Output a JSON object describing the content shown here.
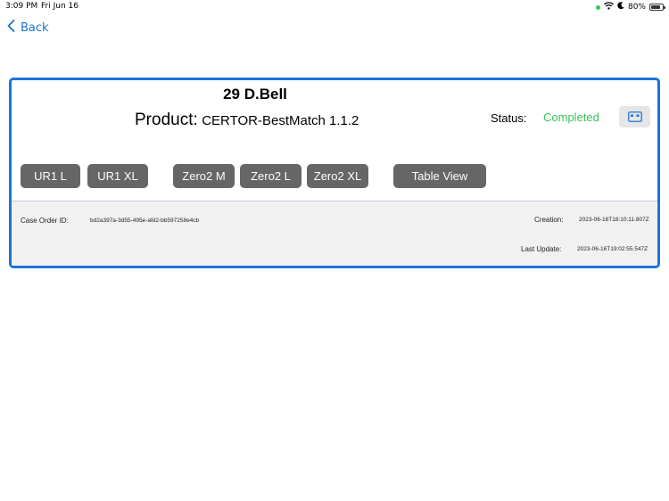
{
  "status_bar": {
    "time": "3:09 PM",
    "date": "Fri Jun 16",
    "battery": "80%",
    "battery_level": 0.8,
    "icons": [
      "recording-dot-icon",
      "wifi-icon",
      "moon-icon",
      "battery-icon"
    ]
  },
  "nav": {
    "back_label": "Back",
    "back_icon": "chevron-left-icon"
  },
  "card": {
    "patient_name": "29 D.Bell",
    "product_label": "Product:",
    "product_value": "CERTOR-BestMatch 1.1.2",
    "status_label": "Status:",
    "status_value": "Completed",
    "status_icon": "id-card-icon",
    "buttons": [
      {
        "label": "UR1 L"
      },
      {
        "label": "UR1 XL"
      },
      {
        "label": "Zero2 M"
      },
      {
        "label": "Zero2 L"
      },
      {
        "label": "Zero2 XL"
      },
      {
        "label": "Table View"
      }
    ],
    "footer": {
      "case_order_label": "Case Order ID:",
      "case_order_value": "bd2a397a-3d55-495e-afd2-bb597258e4cb",
      "creation_label": "Creation:",
      "creation_value": "2023-06-16T18:10:11.807Z",
      "last_update_label": "Last Update:",
      "last_update_value": "2023-06-16T19:02:55.547Z"
    }
  },
  "colors": {
    "accent": "#1e73d9",
    "link": "#1a73c8",
    "status_completed": "#3cc25a",
    "button_bg": "#666666"
  }
}
